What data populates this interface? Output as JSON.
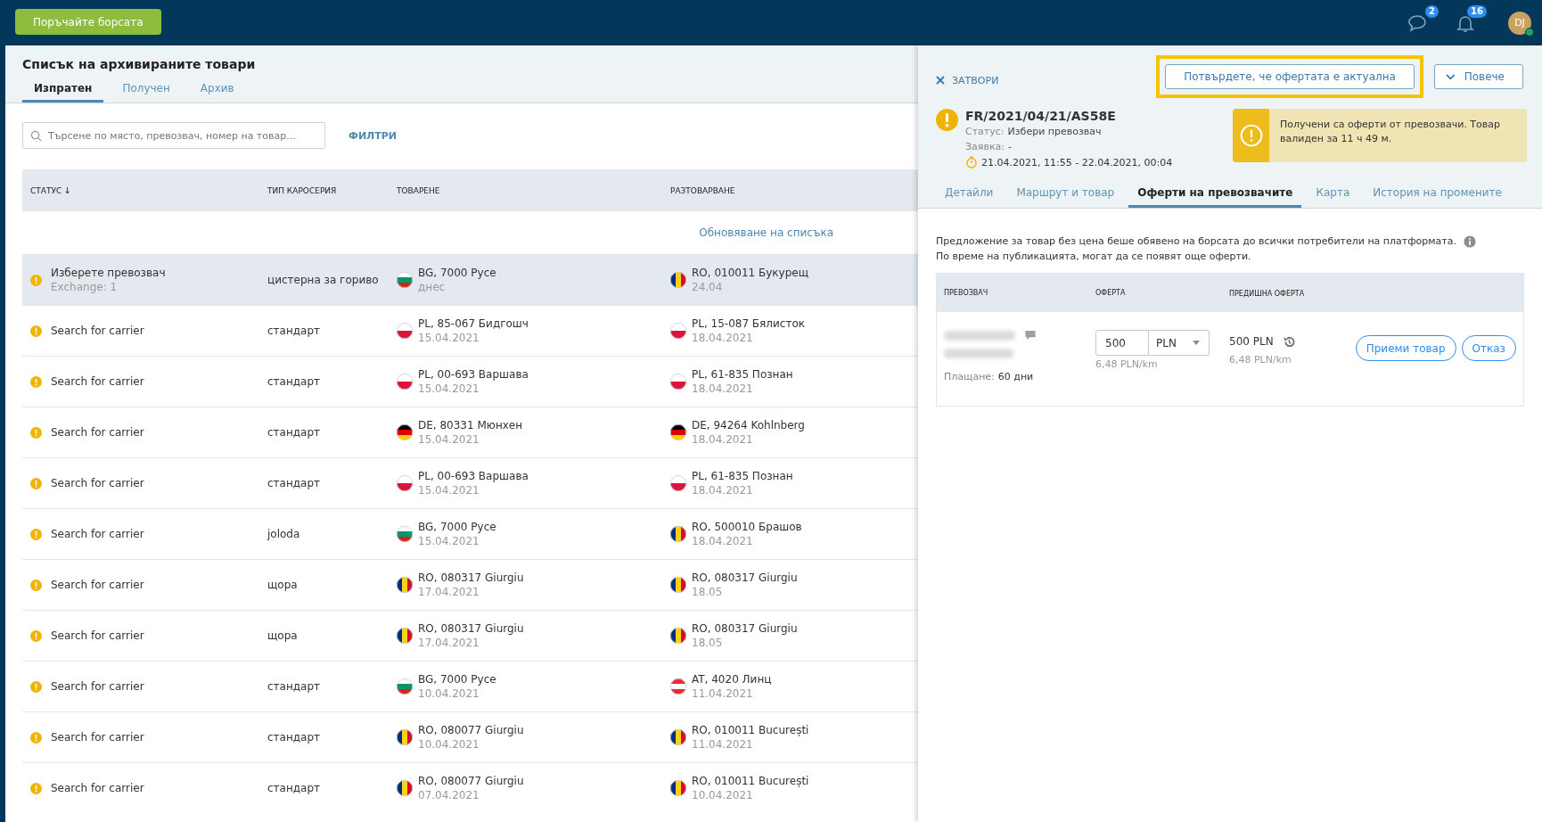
{
  "top_bar": {
    "button": "Поръчайте борсата",
    "messages_badge": "2",
    "notifications_badge": "16",
    "avatar_initials": "DJ",
    "online": true
  },
  "page": {
    "title": "Списък на архивираните товари",
    "tabs": [
      {
        "label": "Изпратен",
        "selected": true
      },
      {
        "label": "Получен",
        "selected": false
      },
      {
        "label": "Архив",
        "selected": false
      }
    ],
    "search": {
      "placeholder": "Търсене по място, превозвач, номер на товар..."
    },
    "filters": "ФИЛТРИ",
    "table": {
      "columns": [
        "СТАТУС",
        "ТИП КАРОСЕРИЯ",
        "ТОВАРЕНЕ",
        "РАЗТОВАРВАНЕ"
      ],
      "sort_arrow": "↓",
      "refresh_link": "Обновяване на списъка",
      "rows": [
        {
          "selected": true,
          "status": "Изберете превозвач",
          "sub": "Exchange: 1",
          "body": "цистерна за гориво",
          "loading": {
            "kind": "bg",
            "place": "BG, 7000 Русе",
            "date": "днес"
          },
          "unloading": {
            "kind": "ro",
            "place": "RO, 010011 Букурещ",
            "date": "24.04"
          }
        },
        {
          "selected": false,
          "status": "Search for carrier",
          "body": "стандарт",
          "loading": {
            "kind": "pl",
            "place": "PL, 85-067 Бидгошч",
            "date": "15.04.2021"
          },
          "unloading": {
            "kind": "pl",
            "place": "PL, 15-087 Бялисток",
            "date": "18.04.2021"
          }
        },
        {
          "selected": false,
          "status": "Search for carrier",
          "body": "стандарт",
          "loading": {
            "kind": "pl",
            "place": "PL, 00-693 Варшава",
            "date": "15.04.2021"
          },
          "unloading": {
            "kind": "pl",
            "place": "PL, 61-835 Познан",
            "date": "18.04.2021"
          }
        },
        {
          "selected": false,
          "status": "Search for carrier",
          "body": "стандарт",
          "loading": {
            "kind": "de",
            "place": "DE, 80331 Мюнхен",
            "date": "15.04.2021"
          },
          "unloading": {
            "kind": "de",
            "place": "DE, 94264 Kohlnberg",
            "date": "18.04.2021"
          }
        },
        {
          "selected": false,
          "status": "Search for carrier",
          "body": "стандарт",
          "loading": {
            "kind": "pl",
            "place": "PL, 00-693 Варшава",
            "date": "15.04.2021"
          },
          "unloading": {
            "kind": "pl",
            "place": "PL, 61-835 Познан",
            "date": "18.04.2021"
          }
        },
        {
          "selected": false,
          "status": "Search for carrier",
          "body": "joloda",
          "loading": {
            "kind": "bg",
            "place": "BG, 7000 Русе",
            "date": "15.04.2021"
          },
          "unloading": {
            "kind": "ro",
            "place": "RO, 500010 Брашов",
            "date": "18.04.2021"
          }
        },
        {
          "selected": false,
          "status": "Search for carrier",
          "body": "щора",
          "loading": {
            "kind": "ro",
            "place": "RO, 080317 Giurgiu",
            "date": "17.04.2021"
          },
          "unloading": {
            "kind": "ro",
            "place": "RO, 080317 Giurgiu",
            "date": "18.05"
          }
        },
        {
          "selected": false,
          "status": "Search for carrier",
          "body": "щора",
          "loading": {
            "kind": "ro",
            "place": "RO, 080317 Giurgiu",
            "date": "17.04.2021"
          },
          "unloading": {
            "kind": "ro",
            "place": "RO, 080317 Giurgiu",
            "date": "18.05"
          }
        },
        {
          "selected": false,
          "status": "Search for carrier",
          "body": "стандарт",
          "loading": {
            "kind": "bg",
            "place": "BG, 7000 Русе",
            "date": "10.04.2021"
          },
          "unloading": {
            "kind": "at",
            "place": "AT, 4020 Линц",
            "date": "11.04.2021"
          }
        },
        {
          "selected": false,
          "status": "Search for carrier",
          "body": "стандарт",
          "loading": {
            "kind": "ro",
            "place": "RO, 080077 Giurgiu",
            "date": "10.04.2021"
          },
          "unloading": {
            "kind": "ro",
            "place": "RO, 010011 București",
            "date": "11.04.2021"
          }
        },
        {
          "selected": false,
          "status": "Search for carrier",
          "body": "стандарт",
          "loading": {
            "kind": "ro",
            "place": "RO, 080077 Giurgiu",
            "date": "07.04.2021"
          },
          "unloading": {
            "kind": "ro",
            "place": "RO, 010011 București",
            "date": "10.04.2021"
          }
        }
      ]
    }
  },
  "detail": {
    "close": "ЗАТВОРИ",
    "confirm_button": "Потвърдете, че офертата е актуална",
    "more_button": "Повече",
    "id": "FR/2021/04/21/AS58E",
    "status_label": "Статус:",
    "status_value": "Избери превозвач",
    "request_label": "Заявка:",
    "request_value": "-",
    "period": "21.04.2021, 11:55 - 22.04.2021, 00:04",
    "alert": "Получени са оферти от превозвачи. Товар валиден за 11 ч 49 м.",
    "tabs": [
      {
        "label": "Детайли",
        "selected": false
      },
      {
        "label": "Маршрут и товар",
        "selected": false
      },
      {
        "label": "Оферти на превозвачите",
        "selected": true
      },
      {
        "label": "Карта",
        "selected": false
      },
      {
        "label": "История на промените",
        "selected": false
      }
    ],
    "info_lines": [
      "Предложение за товар без цена беше обявено на борсата до всички потребители на платформата.",
      "По време на публикацията, могат да се появят още оферти."
    ],
    "offers": {
      "columns": [
        "ПРЕВОЗВАЧ",
        "ОФЕРТА",
        "ПРЕДИШНА ОФЕРТА"
      ],
      "rows": [
        {
          "payment_label": "Плащане:",
          "payment_value": "60 дни",
          "offer_value": "500",
          "currency": "PLN",
          "offer_rate": "6,48 PLN/km",
          "previous": "500 PLN",
          "previous_rate": "6,48 PLN/km",
          "accept": "Приеми товар",
          "reject": "Отказ"
        }
      ]
    }
  }
}
